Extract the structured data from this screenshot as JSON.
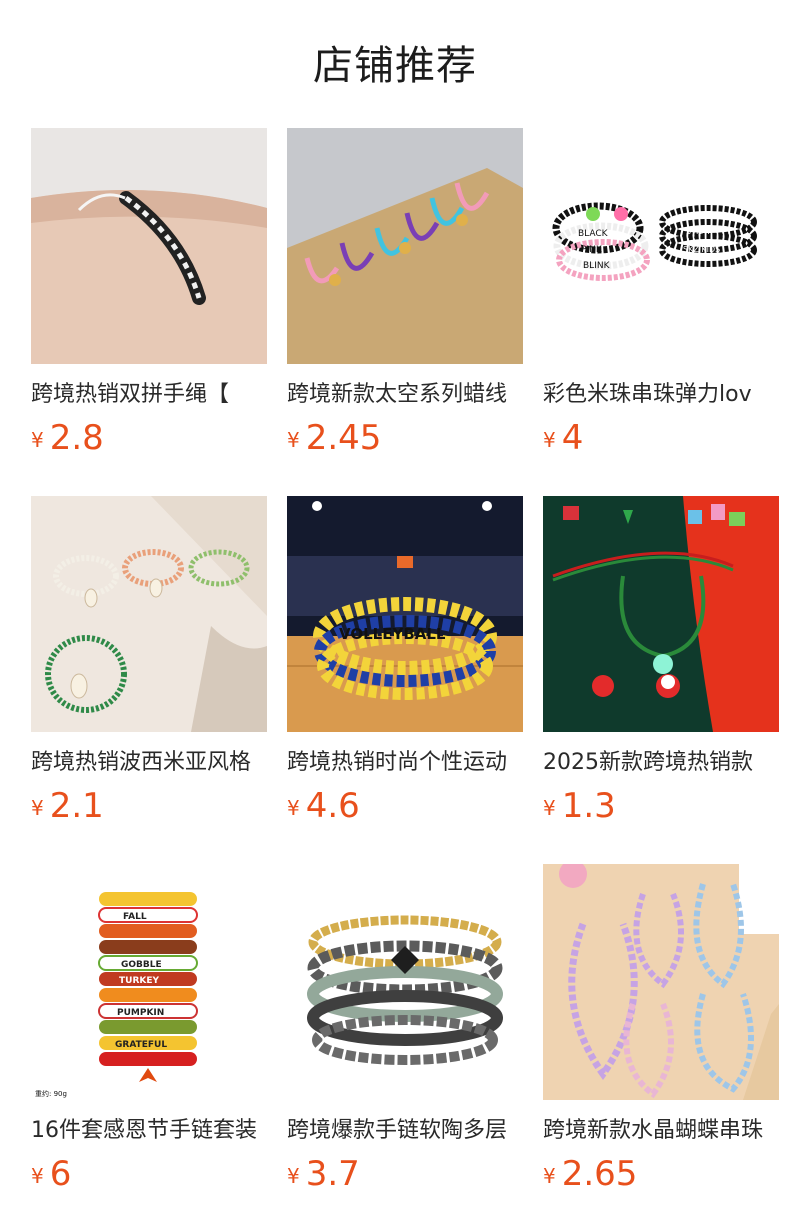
{
  "section_title": "店铺推荐",
  "currency_symbol": "¥",
  "colors": {
    "price": "#e8501c",
    "title": "#1c1c1c"
  },
  "products": [
    {
      "name": "跨境热销双拼手绳【",
      "price": "2.8",
      "image": "black-white-braided-bracelet-photo"
    },
    {
      "name": "跨境新款太空系列蜡线",
      "price": "2.45",
      "image": "colorful-cord-bracelets-photo"
    },
    {
      "name": "彩色米珠串珠弹力lov",
      "price": "4",
      "image": "letter-bead-bracelets-photo"
    },
    {
      "name": "跨境热销波西米亚风格",
      "price": "2.1",
      "image": "shell-bohemian-bracelets-photo"
    },
    {
      "name": "跨境热销时尚个性运动",
      "price": "4.6",
      "image": "volleyball-bead-bracelets-photo"
    },
    {
      "name": "2025新款跨境热销款",
      "price": "1.3",
      "image": "christmas-cord-bracelet-photo"
    },
    {
      "name": "16件套感恩节手链套装",
      "price": "6",
      "image": "thanksgiving-bracelet-stack-photo"
    },
    {
      "name": "跨境爆款手链软陶多层",
      "price": "3.7",
      "image": "polymer-clay-bracelets-photo"
    },
    {
      "name": "跨境新款水晶蝴蝶串珠",
      "price": "2.65",
      "image": "crystal-butterfly-phone-chains-photo"
    }
  ],
  "image_text": {
    "bead_words": [
      "BLACK",
      "PINK",
      "BLINK",
      "STRAY",
      "SKZ KIDS"
    ],
    "volleyball": "VOLLEYBALL",
    "thanksgiving_words": [
      "FALL",
      "GOBBLE",
      "TURKEY",
      "PUMPKIN",
      "GRATEFUL"
    ],
    "weight_label": "重约: 90g"
  }
}
